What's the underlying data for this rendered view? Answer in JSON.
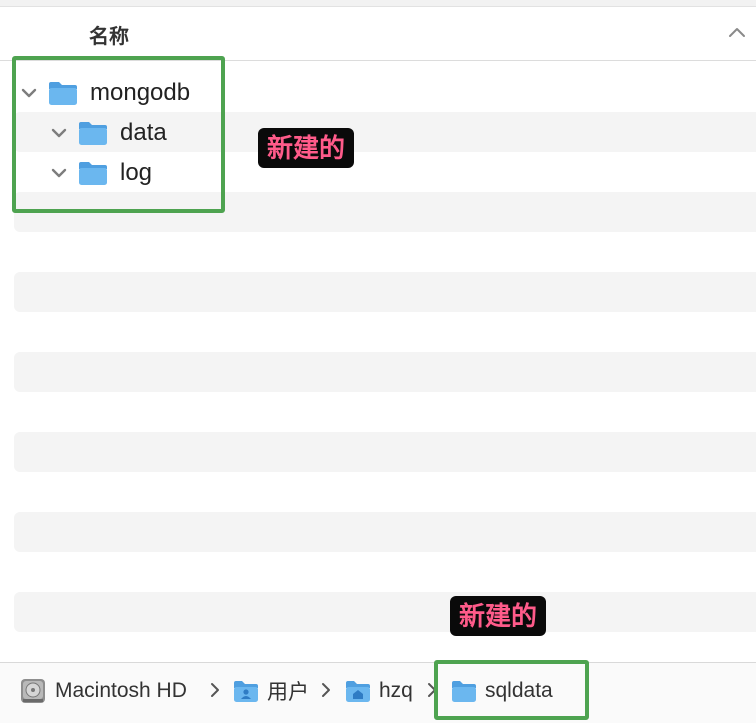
{
  "header": {
    "column_title": "名称"
  },
  "tree": [
    {
      "label": "mongodb",
      "expanded": true
    },
    {
      "label": "data",
      "expanded": true
    },
    {
      "label": "log",
      "expanded": true
    }
  ],
  "annotations": [
    {
      "text": "新建的"
    },
    {
      "text": "新建的"
    }
  ],
  "pathbar": {
    "crumbs": [
      {
        "label": "Macintosh HD",
        "icon": "hard-drive-icon"
      },
      {
        "label": "用户",
        "icon": "users-folder-icon"
      },
      {
        "label": "hzq",
        "icon": "home-folder-icon"
      },
      {
        "label": "sqldata",
        "icon": "folder-icon"
      }
    ]
  },
  "colors": {
    "highlight_frame": "#4ea350",
    "tag_bg": "#0a0a0a",
    "tag_text": "#ff5b8a",
    "folder": "#6bb7ef"
  }
}
